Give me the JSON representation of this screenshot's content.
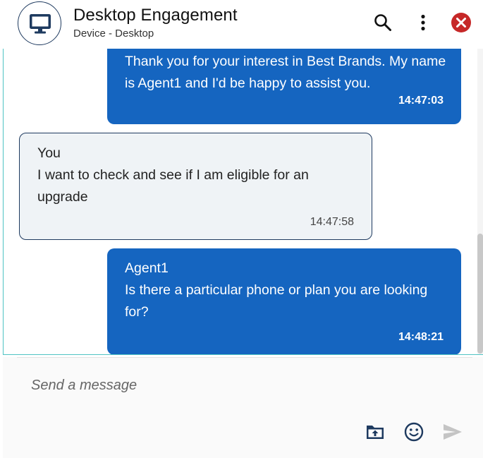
{
  "header": {
    "title": "Desktop Engagement",
    "subtitle": "Device - Desktop"
  },
  "messages": [
    {
      "role": "agent",
      "sender": "",
      "text": "Thank you for your interest in Best Brands. My name is Agent1 and I'd be happy to assist you.",
      "time": "14:47:03"
    },
    {
      "role": "user",
      "sender": "You",
      "text": "I want to check and see if I am eligible for an upgrade",
      "time": "14:47:58"
    },
    {
      "role": "agent",
      "sender": "Agent1",
      "text": "Is there a particular phone or plan you are looking for?",
      "time": "14:48:21"
    }
  ],
  "composer": {
    "placeholder": "Send a message"
  },
  "icons": {
    "avatar": "desktop-monitor-icon",
    "search": "search-icon",
    "more": "more-vertical-icon",
    "close": "close-circle-icon",
    "upload": "folder-upload-icon",
    "emoji": "emoji-icon",
    "send": "send-icon"
  },
  "colors": {
    "agent_bubble": "#1565c0",
    "user_bubble": "#eff3f6",
    "close_button": "#c62828",
    "transcript_border": "#4fc3c3"
  }
}
